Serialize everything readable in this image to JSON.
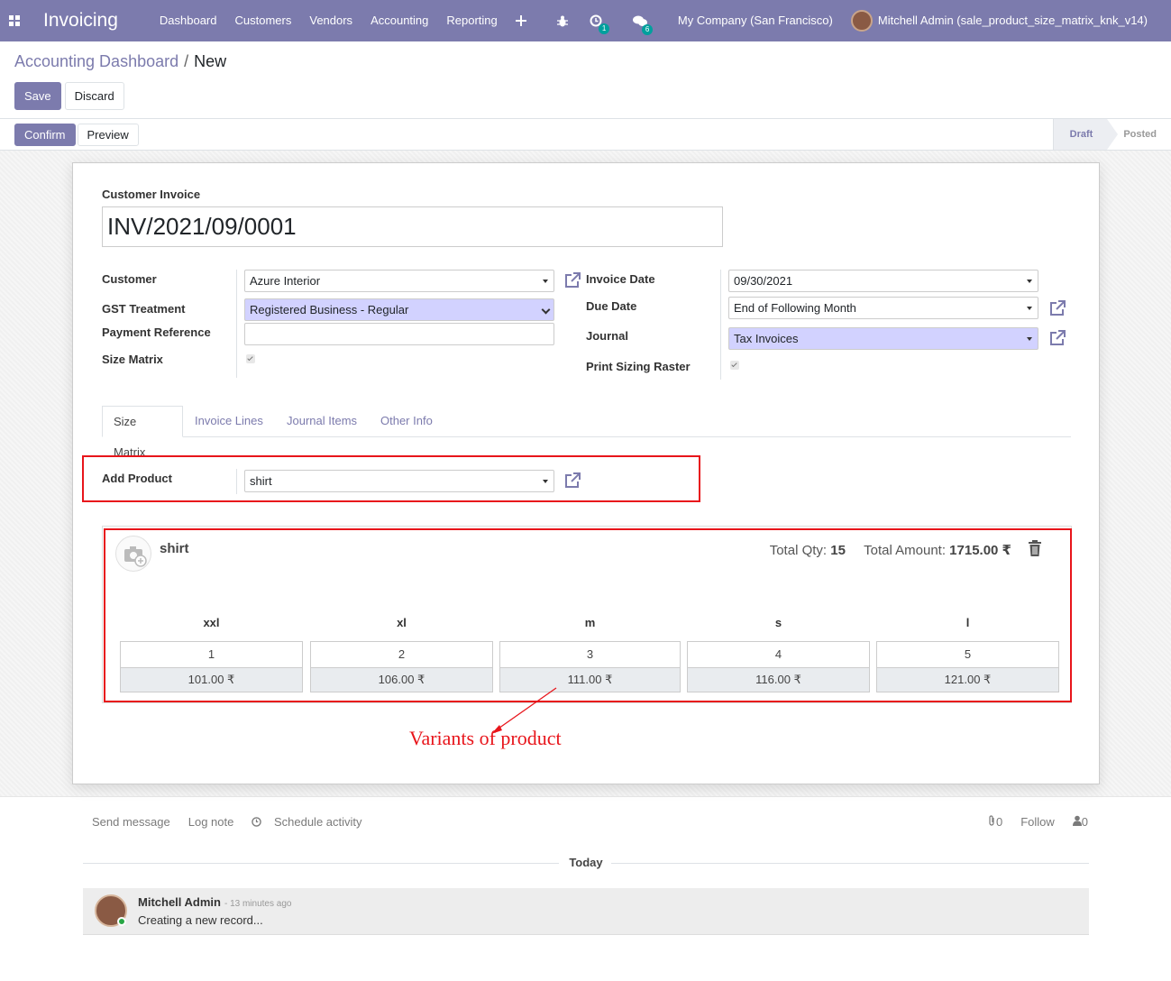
{
  "navbar": {
    "app_title": "Invoicing",
    "menu": [
      "Dashboard",
      "Customers",
      "Vendors",
      "Accounting",
      "Reporting"
    ],
    "activity_count": "1",
    "message_count": "6",
    "company": "My Company (San Francisco)",
    "user": "Mitchell Admin (sale_product_size_matrix_knk_v14)",
    "icons": [
      "apps-grid-icon",
      "plus-icon",
      "bug-icon",
      "clock-icon",
      "chat-icon"
    ]
  },
  "breadcrumb": {
    "parent": "Accounting Dashboard",
    "separator": "/",
    "current": "New"
  },
  "actions": {
    "save": "Save",
    "discard": "Discard",
    "confirm": "Confirm",
    "preview": "Preview"
  },
  "status": {
    "states": [
      "Draft",
      "Posted"
    ],
    "active": "Draft"
  },
  "form": {
    "type_label": "Customer Invoice",
    "number": "INV/2021/09/0001",
    "left": {
      "customer_label": "Customer",
      "customer_value": "Azure Interior",
      "gst_label": "GST Treatment",
      "gst_value": "Registered Business - Regular",
      "payment_ref_label": "Payment Reference",
      "payment_ref_value": "",
      "size_matrix_label": "Size Matrix",
      "size_matrix_checked": true
    },
    "right": {
      "invoice_date_label": "Invoice Date",
      "invoice_date_value": "09/30/2021",
      "due_date_label": "Due Date",
      "due_date_value": "End of Following Month",
      "journal_label": "Journal",
      "journal_value": "Tax Invoices",
      "print_sizing_label": "Print Sizing Raster",
      "print_sizing_checked": true
    },
    "tabs": [
      "Size Matrix",
      "Invoice Lines",
      "Journal Items",
      "Other Info"
    ],
    "active_tab": "Size Matrix",
    "add_product_label": "Add Product",
    "add_product_value": "shirt"
  },
  "matrix": {
    "product": "shirt",
    "total_qty_label": "Total Qty:",
    "total_qty": "15",
    "total_amount_label": "Total Amount:",
    "total_amount": "1715.00 ₹",
    "sizes": [
      {
        "size": "xxl",
        "qty": "1",
        "price": "101.00 ₹"
      },
      {
        "size": "xl",
        "qty": "2",
        "price": "106.00 ₹"
      },
      {
        "size": "m",
        "qty": "3",
        "price": "111.00 ₹"
      },
      {
        "size": "s",
        "qty": "4",
        "price": "116.00 ₹"
      },
      {
        "size": "l",
        "qty": "5",
        "price": "121.00 ₹"
      }
    ]
  },
  "annotation": {
    "text": "Variants of product",
    "color": "#e8151b"
  },
  "chatter": {
    "send_message": "Send message",
    "log_note": "Log note",
    "schedule_activity": "Schedule activity",
    "attachments": "0",
    "follow": "Follow",
    "followers": "0",
    "date_separator": "Today",
    "message": {
      "author": "Mitchell Admin",
      "time": "- 13 minutes ago",
      "body": "Creating a new record..."
    }
  },
  "colors": {
    "brand": "#7c7bad",
    "highlight_field": "#d2d2ff",
    "annotation_red": "#e8151b"
  }
}
